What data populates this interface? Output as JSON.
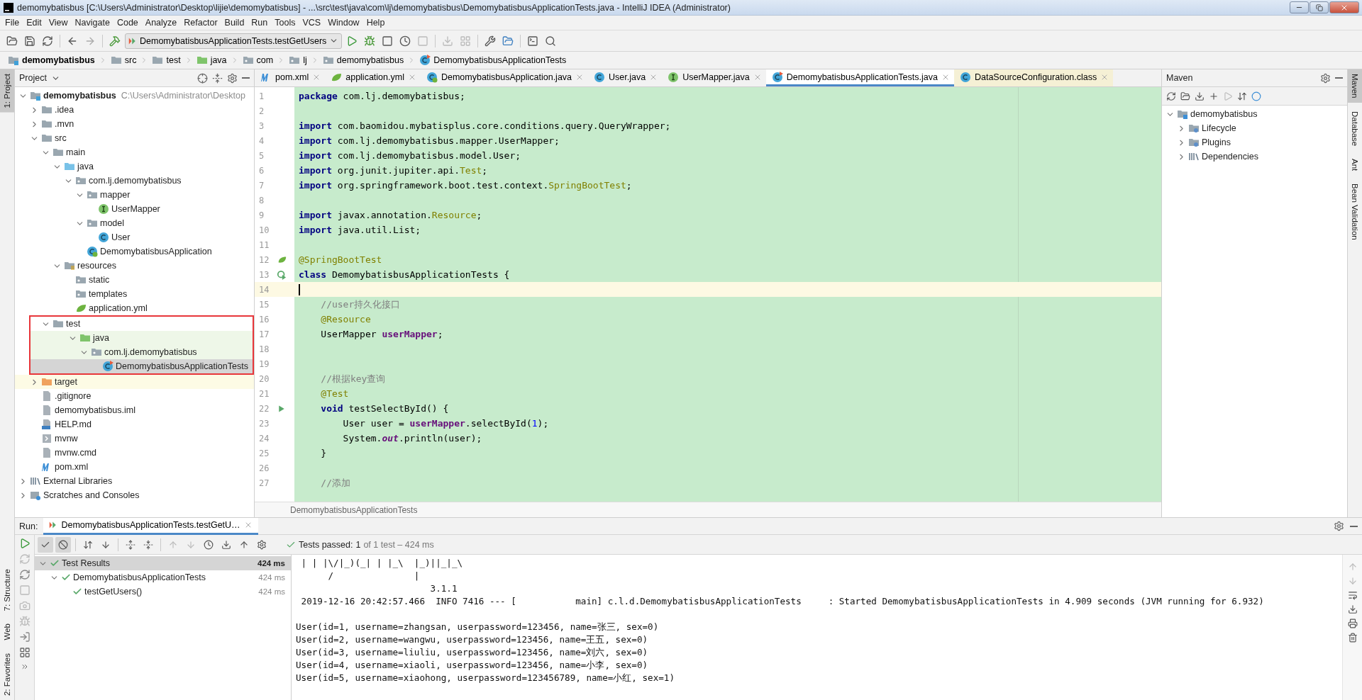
{
  "window": {
    "title": "demomybatisbus [C:\\Users\\Administrator\\Desktop\\lijie\\demomybatisbus] - ...\\src\\test\\java\\com\\lj\\demomybatisbus\\DemomybatisbusApplicationTests.java - IntelliJ IDEA (Administrator)"
  },
  "menu": [
    "File",
    "Edit",
    "View",
    "Navigate",
    "Code",
    "Analyze",
    "Refactor",
    "Build",
    "Run",
    "Tools",
    "VCS",
    "Window",
    "Help"
  ],
  "toolbar": {
    "run_config": "DemomybatisbusApplicationTests.testGetUsers"
  },
  "breadcrumbs": [
    {
      "label": "demomybatisbus",
      "kind": "module"
    },
    {
      "label": "src",
      "kind": "folder"
    },
    {
      "label": "test",
      "kind": "folder"
    },
    {
      "label": "java",
      "kind": "test-folder"
    },
    {
      "label": "com",
      "kind": "package"
    },
    {
      "label": "lj",
      "kind": "package"
    },
    {
      "label": "demomybatisbus",
      "kind": "package"
    },
    {
      "label": "DemomybatisbusApplicationTests",
      "kind": "test-class"
    }
  ],
  "left_stripe": {
    "top": [
      {
        "label": "1: Project",
        "selected": true
      }
    ],
    "bottom": [
      {
        "label": "7: Structure",
        "selected": false
      },
      {
        "label": "Web",
        "selected": false
      },
      {
        "label": "2: Favorites",
        "selected": false
      }
    ]
  },
  "project": {
    "title": "Project",
    "tree": [
      {
        "label": "demomybatisbus",
        "path": "C:\\Users\\Administrator\\Desktop",
        "kind": "module",
        "expanded": true,
        "selected": false,
        "children": [
          {
            "label": ".idea",
            "kind": "folder",
            "expanded": false,
            "selected": false
          },
          {
            "label": ".mvn",
            "kind": "folder",
            "expanded": false,
            "selected": false
          },
          {
            "label": "src",
            "kind": "folder",
            "expanded": true,
            "selected": false,
            "children": [
              {
                "label": "main",
                "kind": "folder",
                "expanded": true,
                "selected": false,
                "children": [
                  {
                    "label": "java",
                    "kind": "source-folder",
                    "expanded": true,
                    "selected": false,
                    "children": [
                      {
                        "label": "com.lj.demomybatisbus",
                        "kind": "package",
                        "expanded": true,
                        "selected": false,
                        "children": [
                          {
                            "label": "mapper",
                            "kind": "package",
                            "expanded": true,
                            "selected": false,
                            "children": [
                              {
                                "label": "UserMapper",
                                "kind": "interface",
                                "selected": false
                              }
                            ]
                          },
                          {
                            "label": "model",
                            "kind": "package",
                            "expanded": true,
                            "selected": false,
                            "children": [
                              {
                                "label": "User",
                                "kind": "class",
                                "selected": false
                              }
                            ]
                          },
                          {
                            "label": "DemomybatisbusApplication",
                            "kind": "spring-class",
                            "selected": false
                          }
                        ]
                      }
                    ]
                  },
                  {
                    "label": "resources",
                    "kind": "resources",
                    "expanded": true,
                    "selected": false,
                    "children": [
                      {
                        "label": "static",
                        "kind": "package",
                        "selected": false
                      },
                      {
                        "label": "templates",
                        "kind": "package",
                        "selected": false
                      },
                      {
                        "label": "application.yml",
                        "kind": "yml",
                        "selected": false
                      }
                    ]
                  }
                ]
              },
              {
                "label": "test",
                "kind": "folder",
                "expanded": true,
                "selected": false,
                "annotated": true,
                "children": [
                  {
                    "label": "java",
                    "kind": "test-folder",
                    "expanded": true,
                    "selected": false,
                    "children": [
                      {
                        "label": "com.lj.demomybatisbus",
                        "kind": "package",
                        "expanded": true,
                        "selected": false,
                        "children": [
                          {
                            "label": "DemomybatisbusApplicationTests",
                            "kind": "test-class",
                            "selected": true
                          }
                        ]
                      }
                    ]
                  }
                ]
              }
            ]
          },
          {
            "label": "target",
            "kind": "excluded",
            "expanded": false,
            "selected": false
          },
          {
            "label": ".gitignore",
            "kind": "file",
            "selected": false
          },
          {
            "label": "demomybatisbus.iml",
            "kind": "file",
            "selected": false
          },
          {
            "label": "HELP.md",
            "kind": "md",
            "selected": false
          },
          {
            "label": "mvnw",
            "kind": "script",
            "selected": false
          },
          {
            "label": "mvnw.cmd",
            "kind": "file",
            "selected": false
          },
          {
            "label": "pom.xml",
            "kind": "maven",
            "selected": false
          }
        ]
      },
      {
        "label": "External Libraries",
        "kind": "library",
        "expanded": false,
        "selected": false
      },
      {
        "label": "Scratches and Consoles",
        "kind": "scratches",
        "expanded": false,
        "selected": false
      }
    ]
  },
  "editor": {
    "tabs": [
      {
        "label": "pom.xml",
        "kind": "maven",
        "selected": false,
        "readonly": false
      },
      {
        "label": "application.yml",
        "kind": "yml",
        "selected": false,
        "readonly": false
      },
      {
        "label": "DemomybatisbusApplication.java",
        "kind": "spring-class",
        "selected": false,
        "readonly": false
      },
      {
        "label": "User.java",
        "kind": "class",
        "selected": false,
        "readonly": false
      },
      {
        "label": "UserMapper.java",
        "kind": "interface",
        "selected": false,
        "readonly": false
      },
      {
        "label": "DemomybatisbusApplicationTests.java",
        "kind": "test-class",
        "selected": true,
        "readonly": false
      },
      {
        "label": "DataSourceConfiguration.class",
        "kind": "class",
        "selected": false,
        "readonly": true
      }
    ],
    "lines": [
      {
        "num": "1",
        "current": false,
        "tokens": [
          {
            "kind": "kw",
            "text": "package"
          },
          {
            "kind": "plain",
            "text": " com.lj.demomybatisbus;"
          }
        ]
      },
      {
        "num": "2",
        "current": false
      },
      {
        "num": "3",
        "current": false,
        "tokens": [
          {
            "kind": "kw",
            "text": "import"
          },
          {
            "kind": "plain",
            "text": " com.baomidou.mybatisplus.core.conditions.query.QueryWrapper;"
          }
        ]
      },
      {
        "num": "4",
        "current": false,
        "tokens": [
          {
            "kind": "kw",
            "text": "import"
          },
          {
            "kind": "plain",
            "text": " com.lj.demomybatisbus.mapper.UserMapper;"
          }
        ]
      },
      {
        "num": "5",
        "current": false,
        "tokens": [
          {
            "kind": "kw",
            "text": "import"
          },
          {
            "kind": "plain",
            "text": " com.lj.demomybatisbus.model.User;"
          }
        ]
      },
      {
        "num": "6",
        "current": false,
        "tokens": [
          {
            "kind": "kw",
            "text": "import"
          },
          {
            "kind": "plain",
            "text": " org.junit.jupiter.api."
          },
          {
            "kind": "ann",
            "text": "Test"
          },
          {
            "kind": "plain",
            "text": ";"
          }
        ]
      },
      {
        "num": "7",
        "current": false,
        "tokens": [
          {
            "kind": "kw",
            "text": "import"
          },
          {
            "kind": "plain",
            "text": " org.springframework.boot.test.context."
          },
          {
            "kind": "ann",
            "text": "SpringBootTest"
          },
          {
            "kind": "plain",
            "text": ";"
          }
        ]
      },
      {
        "num": "8",
        "current": false
      },
      {
        "num": "9",
        "current": false,
        "tokens": [
          {
            "kind": "kw",
            "text": "import"
          },
          {
            "kind": "plain",
            "text": " javax.annotation."
          },
          {
            "kind": "ann",
            "text": "Resource"
          },
          {
            "kind": "plain",
            "text": ";"
          }
        ]
      },
      {
        "num": "10",
        "current": false,
        "tokens": [
          {
            "kind": "kw",
            "text": "import"
          },
          {
            "kind": "plain",
            "text": " java.util.List;"
          }
        ]
      },
      {
        "num": "11",
        "current": false
      },
      {
        "num": "12",
        "current": false,
        "kind": "spring",
        "tokens": [
          {
            "kind": "ann",
            "text": "@SpringBootTest"
          }
        ]
      },
      {
        "num": "13",
        "current": false,
        "kind": "run-class",
        "tokens": [
          {
            "kind": "kw",
            "text": "class"
          },
          {
            "kind": "plain",
            "text": " DemomybatisbusApplicationTests {"
          }
        ]
      },
      {
        "num": "14",
        "current": true
      },
      {
        "num": "15",
        "current": false,
        "tokens": [
          {
            "kind": "comment",
            "text": "    //user持久化接口"
          }
        ]
      },
      {
        "num": "16",
        "current": false,
        "tokens": [
          {
            "kind": "ann",
            "text": "    @Resource"
          }
        ]
      },
      {
        "num": "17",
        "current": false,
        "tokens": [
          {
            "kind": "plain",
            "text": "    UserMapper "
          },
          {
            "kind": "field",
            "text": "userMapper"
          },
          {
            "kind": "plain",
            "text": ";"
          }
        ]
      },
      {
        "num": "18",
        "current": false
      },
      {
        "num": "19",
        "current": false
      },
      {
        "num": "20",
        "current": false,
        "tokens": [
          {
            "kind": "comment",
            "text": "    //根据key查询"
          }
        ]
      },
      {
        "num": "21",
        "current": false,
        "tokens": [
          {
            "kind": "ann",
            "text": "    @Test"
          }
        ]
      },
      {
        "num": "22",
        "current": false,
        "kind": "run",
        "tokens": [
          {
            "kind": "kw",
            "text": "    void"
          },
          {
            "kind": "plain",
            "text": " testSelectById() {"
          }
        ]
      },
      {
        "num": "23",
        "current": false,
        "tokens": [
          {
            "kind": "plain",
            "text": "        User user = "
          },
          {
            "kind": "field",
            "text": "userMapper"
          },
          {
            "kind": "plain",
            "text": ".selectById("
          },
          {
            "kind": "num",
            "text": "1"
          },
          {
            "kind": "plain",
            "text": ");"
          }
        ]
      },
      {
        "num": "24",
        "current": false,
        "tokens": [
          {
            "kind": "plain",
            "text": "        System."
          },
          {
            "kind": "static",
            "text": "out"
          },
          {
            "kind": "plain",
            "text": ".println(user);"
          }
        ]
      },
      {
        "num": "25",
        "current": false,
        "tokens": [
          {
            "kind": "plain",
            "text": "    }"
          }
        ]
      },
      {
        "num": "26",
        "current": false
      },
      {
        "num": "27",
        "current": false,
        "tokens": [
          {
            "kind": "comment",
            "text": "    //添加"
          }
        ]
      }
    ],
    "footer": "DemomybatisbusApplicationTests"
  },
  "maven": {
    "title": "Maven",
    "tree": [
      {
        "label": "demomybatisbus",
        "kind": "maven-module",
        "expanded": true,
        "children": [
          {
            "label": "Lifecycle",
            "kind": "lifecycle",
            "expanded": false
          },
          {
            "label": "Plugins",
            "kind": "lifecycle",
            "expanded": false
          },
          {
            "label": "Dependencies",
            "kind": "library",
            "expanded": false
          }
        ]
      }
    ]
  },
  "right_stripe": [
    {
      "label": "Maven",
      "selected": true
    },
    {
      "label": "Database",
      "selected": false
    },
    {
      "label": "Ant",
      "selected": false
    },
    {
      "label": "Bean Validation",
      "selected": false
    }
  ],
  "run": {
    "label": "Run:",
    "tab": "DemomybatisbusApplicationTests.testGetU…",
    "status": {
      "title": "Tests passed:",
      "count": "1",
      "detail": "of 1 test – 424 ms"
    },
    "results": [
      {
        "label": "Test Results",
        "time": "424 ms",
        "expanded": true,
        "selected": true,
        "children": [
          {
            "label": "DemomybatisbusApplicationTests",
            "time": "424 ms",
            "expanded": true,
            "selected": false,
            "children": [
              {
                "label": "testGetUsers()",
                "time": "424 ms",
                "selected": false
              }
            ]
          }
        ]
      }
    ],
    "console": [
      " | | |\\/|_)(_| | |_\\  |_)||_|_\\",
      "      /               |",
      "                         3.1.1",
      " 2019-12-16 20:42:57.466  INFO 7416 --- [           main] c.l.d.DemomybatisbusApplicationTests     : Started DemomybatisbusApplicationTests in 4.909 seconds (JVM running for 6.932)",
      "User(id=1, username=zhangsan, userpassword=123456, name=张三, sex=0)",
      "User(id=2, username=wangwu, userpassword=123456, name=王五, sex=0)",
      "User(id=3, username=liuliu, userpassword=123456, name=刘六, sex=0)",
      "User(id=4, username=xiaoli, userpassword=123456, name=小李, sex=0)",
      "User(id=5, username=xiaohong, userpassword=123456789, name=小红, sex=1)"
    ]
  }
}
